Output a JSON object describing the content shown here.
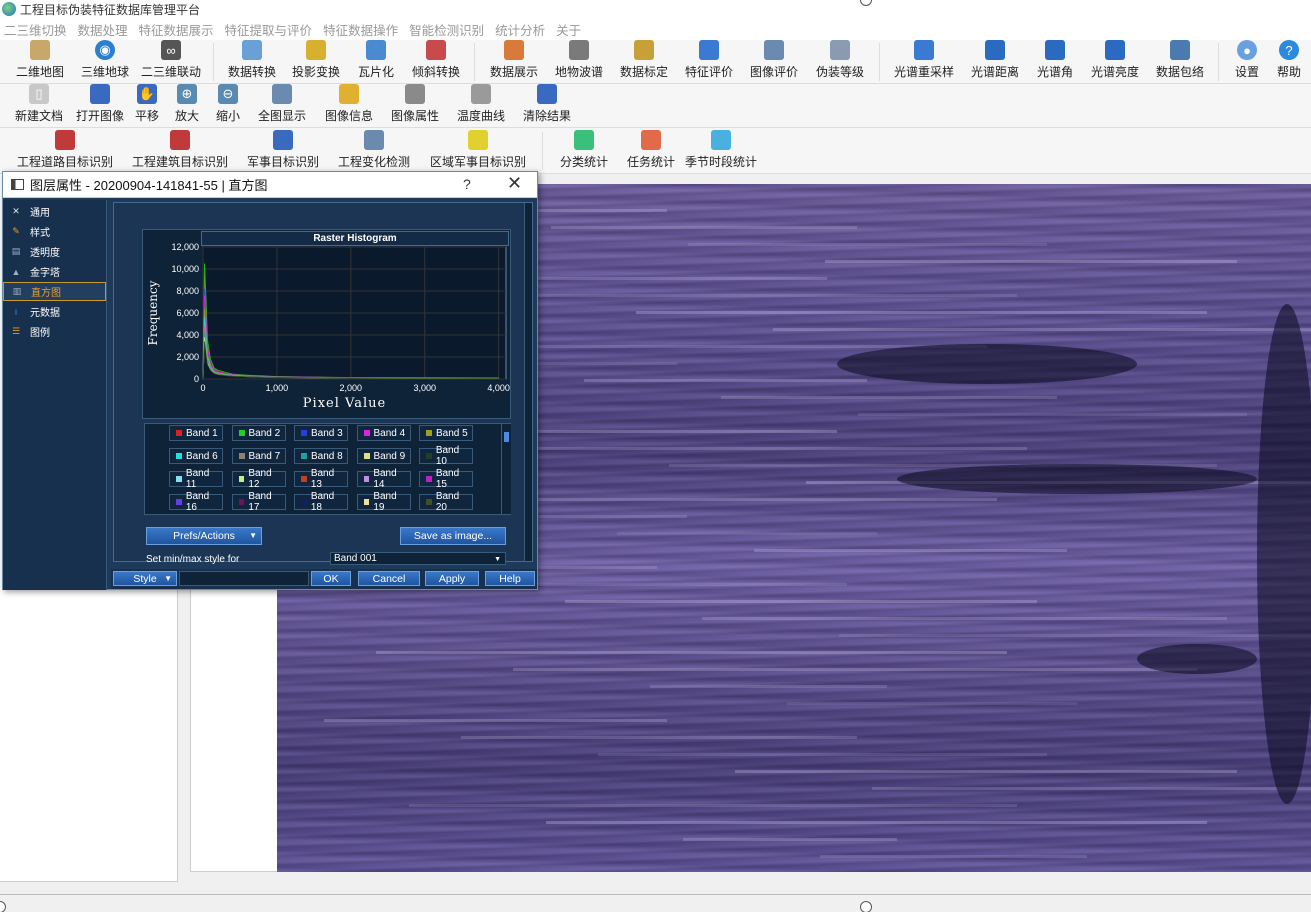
{
  "app": {
    "title": "工程目标伪装特征数据库管理平台"
  },
  "menu": [
    "二三维切换",
    "数据处理",
    "特征数据展示",
    "特征提取与评价",
    "特征数据操作",
    "智能检测识别",
    "统计分析",
    "关于"
  ],
  "toolbar1": [
    {
      "label": "二维地图",
      "icon": "map-2d-icon",
      "color": "#c8a86a"
    },
    {
      "label": "三维地球",
      "icon": "globe-icon",
      "color": "#2a7fd0"
    },
    {
      "label": "二三维联动",
      "icon": "link-icon",
      "color": "#555"
    },
    {
      "label": "数据转换",
      "icon": "data-convert-icon",
      "color": "#6aa0d8"
    },
    {
      "label": "投影变换",
      "icon": "projection-icon",
      "color": "#d8b030"
    },
    {
      "label": "瓦片化",
      "icon": "tiles-icon",
      "color": "#4a8ad0"
    },
    {
      "label": "倾斜转换",
      "icon": "oblique-icon",
      "color": "#c84a4a"
    },
    {
      "label": "数据展示",
      "icon": "display-icon",
      "color": "#d87a3a"
    },
    {
      "label": "地物波谱",
      "icon": "spectrum-icon",
      "color": "#7a7a7a"
    },
    {
      "label": "数据标定",
      "icon": "calibrate-icon",
      "color": "#c8a03a"
    },
    {
      "label": "特征评价",
      "icon": "feature-eval-icon",
      "color": "#3a7ad0"
    },
    {
      "label": "图像评价",
      "icon": "image-eval-icon",
      "color": "#6a8ab0"
    },
    {
      "label": "伪装等级",
      "icon": "camo-level-icon",
      "color": "#8a9ab0"
    },
    {
      "label": "光谱重采样",
      "icon": "resample-icon",
      "color": "#3a7ad0"
    },
    {
      "label": "光谱距离",
      "icon": "spectral-distance-icon",
      "color": "#2a6ac0"
    },
    {
      "label": "光谱角",
      "icon": "spectral-angle-icon",
      "color": "#2a6ac0"
    },
    {
      "label": "光谱亮度",
      "icon": "brightness-icon",
      "color": "#2a6ac0"
    },
    {
      "label": "数据包络",
      "icon": "envelope-icon",
      "color": "#4a7ab0"
    },
    {
      "label": "设置",
      "icon": "settings-icon",
      "color": "#6aa0e0"
    },
    {
      "label": "帮助",
      "icon": "help-icon",
      "color": "#2a8ae0"
    }
  ],
  "toolbar2": [
    {
      "label": "新建文档",
      "icon": "new-doc-icon",
      "color": "#c8c8c8"
    },
    {
      "label": "打开图像",
      "icon": "open-image-icon",
      "color": "#3a6ac0"
    },
    {
      "label": "平移",
      "icon": "pan-icon",
      "color": "#3a6ac0"
    },
    {
      "label": "放大",
      "icon": "zoom-in-icon",
      "color": "#5a8ab0"
    },
    {
      "label": "缩小",
      "icon": "zoom-out-icon",
      "color": "#5a8ab0"
    },
    {
      "label": "全图显示",
      "icon": "full-extent-icon",
      "color": "#6a8ab0"
    },
    {
      "label": "图像信息",
      "icon": "image-info-icon",
      "color": "#e0b030"
    },
    {
      "label": "图像属性",
      "icon": "image-props-icon",
      "color": "#8a8a8a"
    },
    {
      "label": "温度曲线",
      "icon": "temperature-curve-icon",
      "color": "#9a9a9a"
    },
    {
      "label": "清除结果",
      "icon": "clear-icon",
      "color": "#3a6ac0"
    }
  ],
  "toolbar3": [
    {
      "label": "工程道路目标识别",
      "icon": "road-detect-icon",
      "color": "#c03a3a"
    },
    {
      "label": "工程建筑目标识别",
      "icon": "building-detect-icon",
      "color": "#c03a3a"
    },
    {
      "label": "军事目标识别",
      "icon": "military-detect-icon",
      "color": "#3a6ac0"
    },
    {
      "label": "工程变化检测",
      "icon": "change-detect-icon",
      "color": "#6a8ab0"
    },
    {
      "label": "区域军事目标识别",
      "icon": "region-detect-icon",
      "color": "#e0d030"
    },
    {
      "label": "分类统计",
      "icon": "classify-stats-icon",
      "color": "#3ac07a"
    },
    {
      "label": "任务统计",
      "icon": "task-stats-icon",
      "color": "#e06a4a"
    },
    {
      "label": "季节时段统计",
      "icon": "season-stats-icon",
      "color": "#4ab0e0"
    }
  ],
  "dialog": {
    "title": "图层属性 - 20200904-141841-55 | 直方图",
    "help": "?",
    "close": "✕",
    "nav": [
      {
        "label": "通用",
        "icon": "general-icon",
        "color": "#e0e0e0"
      },
      {
        "label": "样式",
        "icon": "style-icon",
        "color": "#e0a030"
      },
      {
        "label": "透明度",
        "icon": "transparency-icon",
        "color": "#a0b0c0"
      },
      {
        "label": "金字塔",
        "icon": "pyramid-icon",
        "color": "#a0b0c0"
      },
      {
        "label": "直方图",
        "icon": "histogram-icon",
        "color": "#a0b0c0"
      },
      {
        "label": "元数据",
        "icon": "metadata-icon",
        "color": "#3a8ae0"
      },
      {
        "label": "图例",
        "icon": "legend-icon",
        "color": "#e0a030"
      }
    ],
    "selected_nav": "直方图",
    "prefs_label": "Prefs/Actions",
    "save_label": "Save as image...",
    "minmax_label": "Set min/max style for",
    "band_select": "Band 001",
    "style_label": "Style",
    "ok": "OK",
    "cancel": "Cancel",
    "apply": "Apply",
    "help_btn": "Help"
  },
  "chart_data": {
    "type": "line",
    "title": "Raster Histogram",
    "xlabel": "Pixel Value",
    "ylabel": "Frequency",
    "xlim": [
      0,
      4100
    ],
    "ylim": [
      0,
      12000
    ],
    "xticks": [
      "0",
      "1,000",
      "2,000",
      "3,000",
      "4,000"
    ],
    "yticks": [
      "0",
      "2,000",
      "4,000",
      "6,000",
      "8,000",
      "10,000",
      "12,000"
    ],
    "grid": true,
    "x": [
      0,
      20,
      40,
      60,
      100,
      150,
      200,
      300,
      400,
      600,
      800,
      1000,
      1500,
      2000,
      3000,
      4000
    ],
    "series": [
      {
        "name": "Band 1",
        "color": "#e02020",
        "values": [
          0,
          9200,
          6500,
          3000,
          1600,
          900,
          700,
          500,
          400,
          300,
          250,
          200,
          150,
          120,
          100,
          80
        ]
      },
      {
        "name": "Band 2",
        "color": "#20d020",
        "values": [
          0,
          10500,
          7200,
          3600,
          1800,
          1000,
          800,
          600,
          450,
          350,
          280,
          220,
          170,
          130,
          110,
          90
        ]
      },
      {
        "name": "Band 3",
        "color": "#2040e0",
        "values": [
          0,
          8200,
          5000,
          2600,
          1300,
          800,
          600,
          450,
          350,
          280,
          220,
          180,
          140,
          110,
          90,
          70
        ]
      },
      {
        "name": "Band 4",
        "color": "#e020e0",
        "values": [
          0,
          7600,
          5600,
          2800,
          1400,
          850,
          650,
          480,
          380,
          290,
          230,
          190,
          150,
          115,
          95,
          75
        ]
      },
      {
        "name": "Band 5",
        "color": "#a0a020",
        "values": [
          0,
          6400,
          4200,
          2200,
          1200,
          700,
          550,
          420,
          330,
          260,
          210,
          170,
          130,
          105,
          85,
          70
        ]
      },
      {
        "name": "Band 6",
        "color": "#20e0e0",
        "values": [
          0,
          5600,
          3800,
          2000,
          1100,
          650,
          500,
          400,
          320,
          250,
          200,
          160,
          125,
          100,
          80,
          65
        ]
      },
      {
        "name": "Band 7",
        "color": "#908070",
        "values": [
          0,
          4800,
          3200,
          1800,
          1000,
          600,
          480,
          380,
          300,
          240,
          190,
          150,
          120,
          95,
          78,
          62
        ]
      },
      {
        "name": "Band 8",
        "color": "#20a0a0",
        "values": [
          0,
          4200,
          2900,
          1600,
          900,
          560,
          450,
          360,
          290,
          230,
          180,
          145,
          115,
          92,
          75,
          60
        ]
      },
      {
        "name": "Band 9",
        "color": "#e0e080",
        "values": [
          0,
          3800,
          2600,
          1450,
          850,
          530,
          420,
          340,
          270,
          220,
          175,
          140,
          110,
          90,
          72,
          58
        ]
      },
      {
        "name": "Band 10",
        "color": "#204020",
        "values": [
          0,
          3400,
          2300,
          1300,
          780,
          500,
          400,
          320,
          260,
          210,
          170,
          135,
          108,
          88,
          70,
          56
        ]
      }
    ],
    "legend": [
      "Band 1",
      "Band 2",
      "Band 3",
      "Band 4",
      "Band 5",
      "Band 6",
      "Band 7",
      "Band 8",
      "Band 9",
      "Band 10",
      "Band 11",
      "Band 12",
      "Band 13",
      "Band 14",
      "Band 15",
      "Band 16",
      "Band 17",
      "Band 18",
      "Band 19",
      "Band 20"
    ],
    "legend_colors": [
      "#e02020",
      "#20d020",
      "#2040e0",
      "#e020e0",
      "#a0a020",
      "#20e0e0",
      "#908070",
      "#20a0a0",
      "#e0e080",
      "#204020",
      "#80e0f0",
      "#c0f080",
      "#c04020",
      "#c090e0",
      "#c020c0",
      "#6040e0",
      "#701060",
      "#102060",
      "#f0e0a0",
      "#405020"
    ],
    "legend_position": "bottom"
  }
}
